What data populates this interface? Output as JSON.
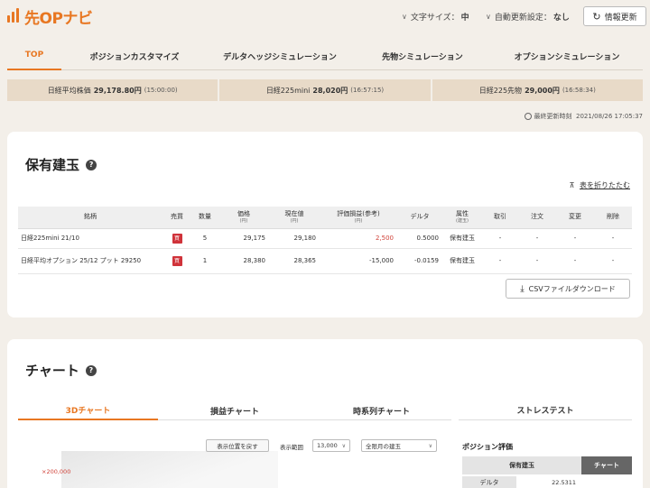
{
  "app": {
    "logo": "先OPナビ",
    "brand_color": "#e87722"
  },
  "header": {
    "font_size_label": "文字サイズ：",
    "font_size_value": "中",
    "auto_refresh_label": "自動更新設定：",
    "auto_refresh_value": "なし",
    "refresh_button": "情報更新"
  },
  "tabs": [
    "TOP",
    "ポジションカスタマイズ",
    "デルタヘッジシミュレーション",
    "先物シミュレーション",
    "オプションシミュレーション"
  ],
  "prices": [
    {
      "name": "日経平均株価",
      "value": "29,178.80円",
      "time": "(15:00:00)"
    },
    {
      "name": "日経225mini",
      "value": "28,020円",
      "time": "(16:57:15)"
    },
    {
      "name": "日経225先物",
      "value": "29,000円",
      "time": "(16:58:34)"
    }
  ],
  "last_updated": {
    "label": "最終更新時刻",
    "value": "2021/08/26 17:05:37"
  },
  "holdings": {
    "title": "保有建玉",
    "help": "?",
    "collapse_link": "表を折りたたむ",
    "columns": [
      {
        "label": "銘柄",
        "sub": ""
      },
      {
        "label": "売買",
        "sub": ""
      },
      {
        "label": "数量",
        "sub": ""
      },
      {
        "label": "価格",
        "sub": "(円)"
      },
      {
        "label": "現在値",
        "sub": "(円)"
      },
      {
        "label": "評価損益(参考)",
        "sub": "(円)"
      },
      {
        "label": "デルタ",
        "sub": ""
      },
      {
        "label": "属性",
        "sub": "(建玉)"
      },
      {
        "label": "取引",
        "sub": ""
      },
      {
        "label": "注文",
        "sub": ""
      },
      {
        "label": "変更",
        "sub": ""
      },
      {
        "label": "削除",
        "sub": ""
      }
    ],
    "rows": [
      {
        "name": "日経225mini 21/10",
        "side": "買",
        "qty": "5",
        "price": "29,175",
        "current": "29,180",
        "pl": "2,500",
        "delta": "0.5000",
        "attr": "保有建玉",
        "trade": "-",
        "order": "-",
        "change": "-",
        "delete": "-"
      },
      {
        "name": "日経平均オプション 25/12 プット 29250",
        "side": "買",
        "qty": "1",
        "price": "28,380",
        "current": "28,365",
        "pl": "-15,000",
        "delta": "-0.0159",
        "attr": "保有建玉",
        "trade": "-",
        "order": "-",
        "change": "-",
        "delete": "-"
      }
    ],
    "csv_button": "CSVファイルダウンロード"
  },
  "chart_section": {
    "title": "チャート",
    "help": "?",
    "tabs": [
      "3Dチャート",
      "損益チャート",
      "時系列チャート"
    ],
    "stress_tab": "ストレステスト",
    "reset_view_button": "表示位置を戻す",
    "range_label": "表示範囲",
    "range_value": "13,000",
    "month_value": "全限月の建玉",
    "y_tick": "×200,000",
    "position_eval": {
      "title": "ポジション評価",
      "col_holding": "保有建玉",
      "col_chart": "チャート",
      "row_label": "デルタ",
      "row_value": "22.5311"
    }
  }
}
